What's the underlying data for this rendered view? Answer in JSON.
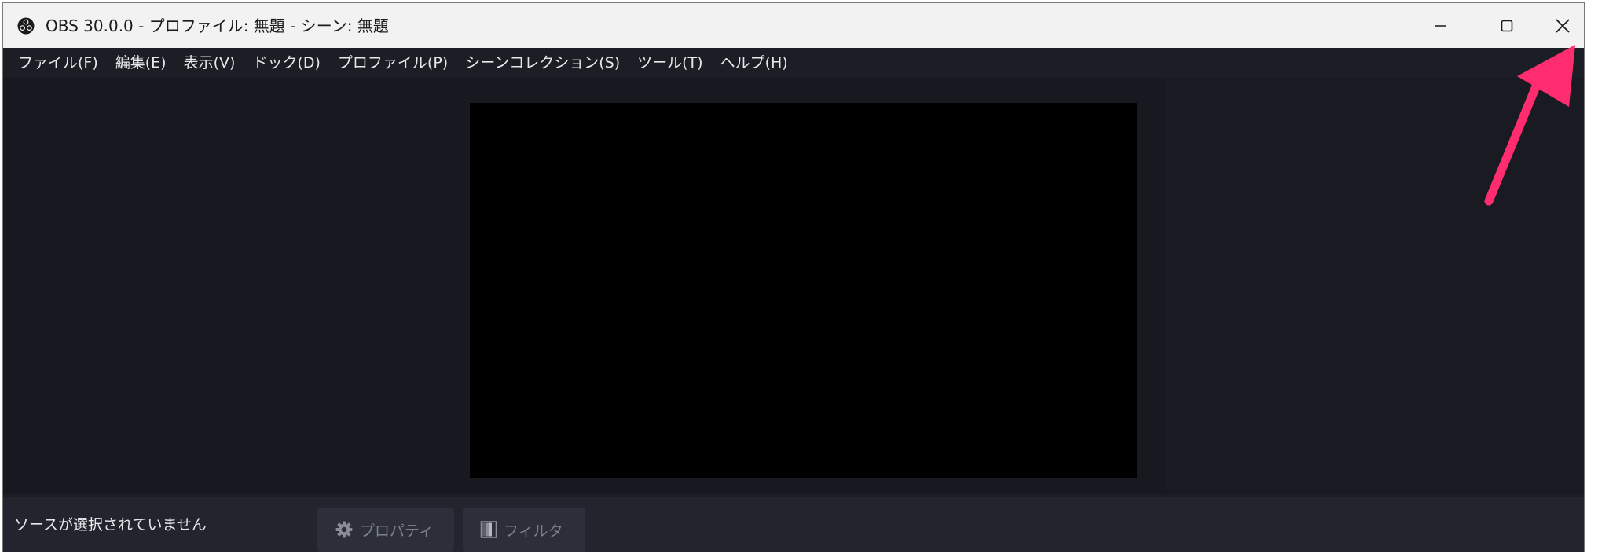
{
  "window": {
    "title": "OBS 30.0.0 - プロファイル: 無題 - シーン: 無題"
  },
  "menu": {
    "items": [
      {
        "label": "ファイル(F)"
      },
      {
        "label": "編集(E)"
      },
      {
        "label": "表示(V)"
      },
      {
        "label": "ドック(D)"
      },
      {
        "label": "プロファイル(P)"
      },
      {
        "label": "シーンコレクション(S)"
      },
      {
        "label": "ツール(T)"
      },
      {
        "label": "ヘルプ(H)"
      }
    ]
  },
  "sources_toolbar": {
    "status": "ソースが選択されていません",
    "properties_label": "プロパティ",
    "filters_label": "フィルタ"
  },
  "icons": {
    "app": "obs-logo-icon",
    "minimize": "minimize-icon",
    "maximize": "maximize-icon",
    "close": "close-icon",
    "properties": "gear-icon",
    "filters": "filter-icon",
    "annotation": "arrow-icon"
  },
  "colors": {
    "annotation_arrow": "#ff2d6f",
    "window_background": "#1c1e26",
    "preview": "#000000",
    "titlebar": "#f2f2f2"
  }
}
